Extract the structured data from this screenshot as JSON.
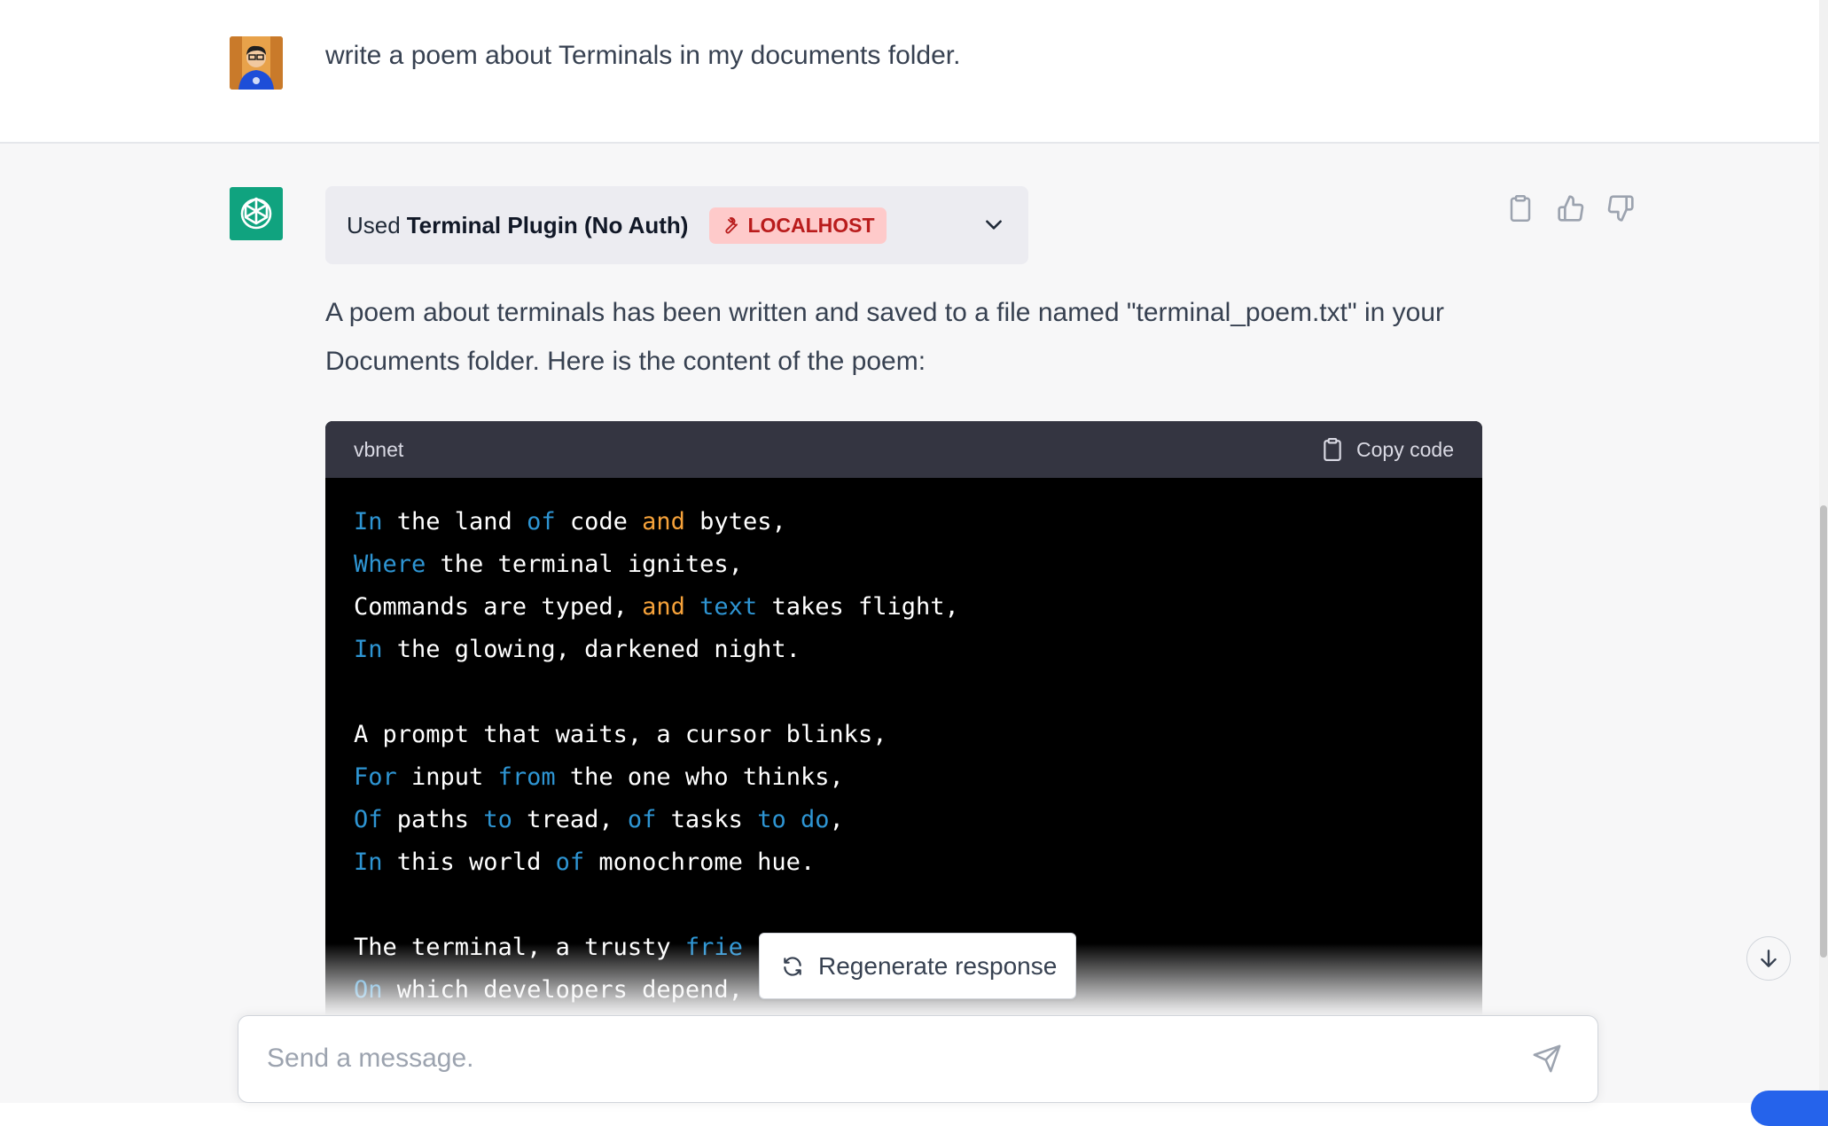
{
  "user_message": {
    "text": "write a poem about Terminals in my documents folder."
  },
  "assistant": {
    "plugin": {
      "used_label": "Used",
      "name": "Terminal Plugin (No Auth)",
      "badge": "LOCALHOST",
      "badge_icon": "wrench-icon"
    },
    "response_text": "A poem about terminals has been written and saved to a file named \"terminal_poem.txt\" in your Documents folder. Here is the content of the poem:",
    "code": {
      "language": "vbnet",
      "copy_label": "Copy code",
      "lines": [
        [
          [
            "kw",
            "In"
          ],
          [
            "t",
            " the land "
          ],
          [
            "kw",
            "of"
          ],
          [
            "t",
            " code "
          ],
          [
            "or",
            "and"
          ],
          [
            "t",
            " bytes,"
          ]
        ],
        [
          [
            "kw",
            "Where"
          ],
          [
            "t",
            " the terminal ignites,"
          ]
        ],
        [
          [
            "t",
            "Commands are typed, "
          ],
          [
            "or",
            "and"
          ],
          [
            "t",
            " "
          ],
          [
            "kw",
            "text"
          ],
          [
            "t",
            " takes flight,"
          ]
        ],
        [
          [
            "kw",
            "In"
          ],
          [
            "t",
            " the glowing, darkened night."
          ]
        ],
        [],
        [
          [
            "t",
            "A prompt that waits, a cursor blinks,"
          ]
        ],
        [
          [
            "kw",
            "For"
          ],
          [
            "t",
            " input "
          ],
          [
            "kw",
            "from"
          ],
          [
            "t",
            " the one who thinks,"
          ]
        ],
        [
          [
            "kw",
            "Of"
          ],
          [
            "t",
            " paths "
          ],
          [
            "kw",
            "to"
          ],
          [
            "t",
            " tread, "
          ],
          [
            "kw",
            "of"
          ],
          [
            "t",
            " tasks "
          ],
          [
            "kw",
            "to"
          ],
          [
            "t",
            " "
          ],
          [
            "kw",
            "do"
          ],
          [
            "t",
            ","
          ]
        ],
        [
          [
            "kw",
            "In"
          ],
          [
            "t",
            " this world "
          ],
          [
            "kw",
            "of"
          ],
          [
            "t",
            " monochrome hue."
          ]
        ],
        [],
        [
          [
            "t",
            "The terminal, a trusty "
          ],
          [
            "kw",
            "frie"
          ]
        ],
        [
          [
            "kw",
            "On"
          ],
          [
            "t",
            " which developers depend,"
          ]
        ]
      ]
    }
  },
  "regenerate_label": "Regenerate response",
  "composer": {
    "placeholder": "Send a message."
  },
  "colors": {
    "keyword_blue": "#2e95d3",
    "keyword_orange": "#f6a23a",
    "badge_bg": "#fecaca",
    "badge_text": "#b91c1c",
    "bot_avatar": "#10a37f"
  }
}
